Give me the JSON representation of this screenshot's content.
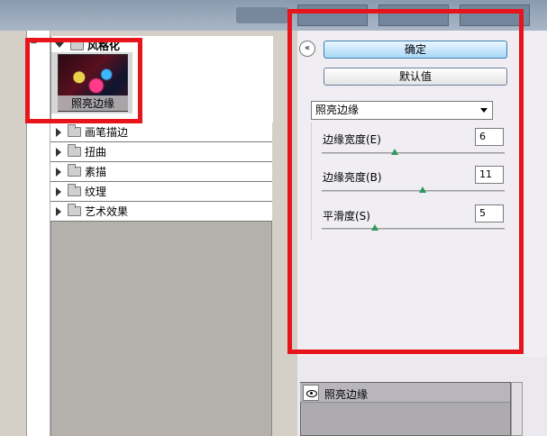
{
  "tree": {
    "open_group_label": "风格化",
    "selected_filter_label": "照亮边缘",
    "groups": [
      {
        "label": "画笔描边"
      },
      {
        "label": "扭曲"
      },
      {
        "label": "素描"
      },
      {
        "label": "纹理"
      },
      {
        "label": "艺术效果"
      }
    ]
  },
  "panel": {
    "collapse_icon": "«",
    "ok_label": "确定",
    "default_label": "默认值",
    "filter_select_value": "照亮边缘",
    "params": [
      {
        "label": "边缘宽度(E)",
        "value": "6",
        "slider": 0.4
      },
      {
        "label": "边缘亮度(B)",
        "value": "11",
        "slider": 0.55
      },
      {
        "label": "平滑度(S)",
        "value": "5",
        "slider": 0.29
      }
    ]
  },
  "layers": {
    "name": "照亮边缘"
  },
  "colors": {
    "highlight_red": "#e8141c",
    "ok_button": "#a9d8f7",
    "slider_thumb": "#2b9a5c"
  }
}
